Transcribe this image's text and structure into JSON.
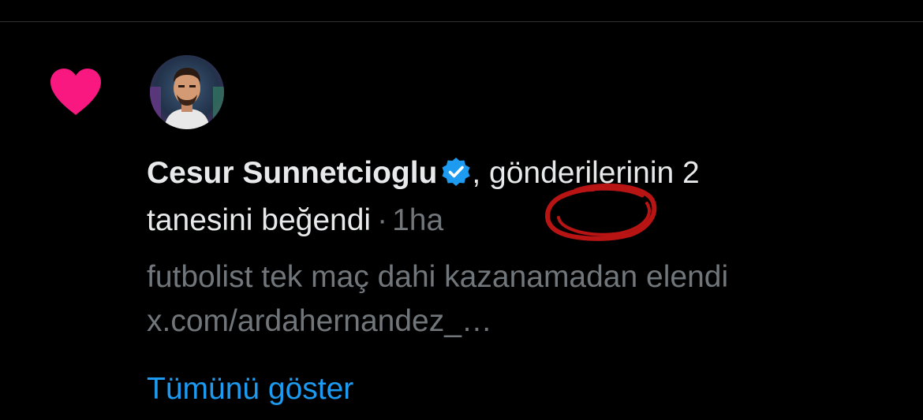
{
  "notification": {
    "icon": "heart-icon",
    "icon_color": "#f91880",
    "author_name": "Cesur Sunnetcioglu",
    "verified": true,
    "verified_color": "#1d9bf0",
    "action_text_line1": ", gönderilerinin 2",
    "action_text_line2": "tanesini beğendi",
    "separator": "·",
    "timestamp": "1ha",
    "snippet_text": "futbolist tek maç dahi kazanamadan elendi",
    "snippet_link": "x.com/ardahernandez_…",
    "show_all_label": "Tümünü göster"
  },
  "colors": {
    "background": "#000000",
    "primary_text": "#e7e9ea",
    "secondary_text": "#71767b",
    "link": "#1d9bf0",
    "annotation": "#b81414"
  }
}
